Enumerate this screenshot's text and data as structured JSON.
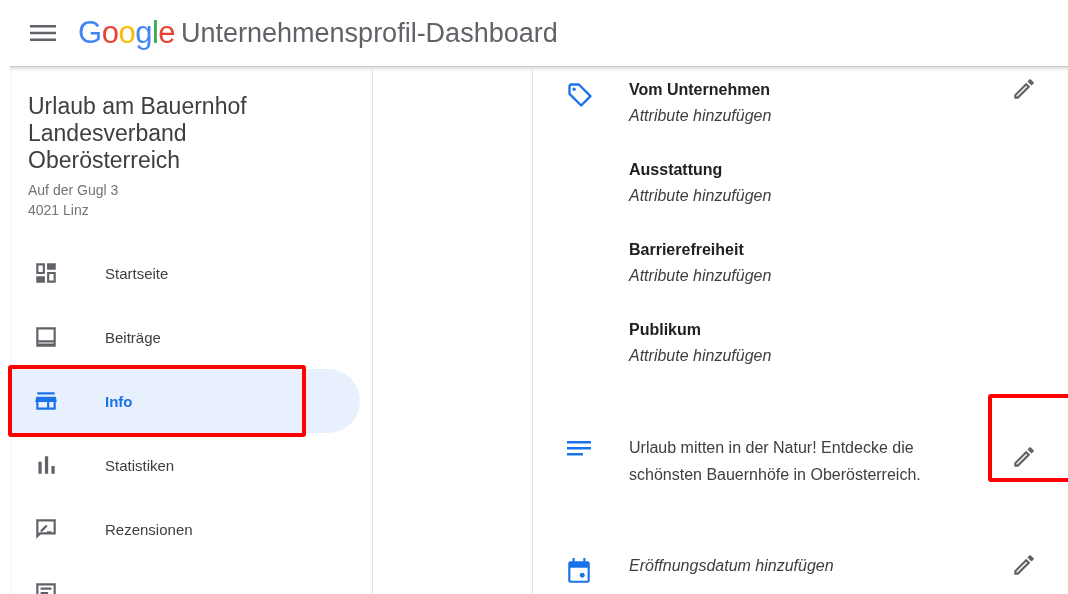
{
  "header": {
    "logo_letters": [
      {
        "char": "G",
        "color": "#4285f4"
      },
      {
        "char": "o",
        "color": "#ea4335"
      },
      {
        "char": "o",
        "color": "#fbbc05"
      },
      {
        "char": "g",
        "color": "#4285f4"
      },
      {
        "char": "l",
        "color": "#34a853"
      },
      {
        "char": "e",
        "color": "#ea4335"
      }
    ],
    "title": "Unternehmensprofil-Dashboard"
  },
  "business": {
    "name": "Urlaub am Bauernhof Landesverband Oberösterreich",
    "address_lines": [
      "Auf der Gugl 3",
      "4021 Linz"
    ]
  },
  "nav": [
    {
      "kind": "dashboard",
      "label": "Startseite",
      "selected": false,
      "highlighted": false
    },
    {
      "kind": "posts",
      "label": "Beiträge",
      "selected": false,
      "highlighted": false
    },
    {
      "kind": "store",
      "label": "Info",
      "selected": true,
      "highlighted": true
    },
    {
      "kind": "chart",
      "label": "Statistiken",
      "selected": false,
      "highlighted": false
    },
    {
      "kind": "review",
      "label": "Rezensionen",
      "selected": false,
      "highlighted": false
    },
    {
      "kind": "message",
      "selected": false,
      "highlighted": false
    }
  ],
  "sections": [
    {
      "kind": "attributes",
      "groups": [
        {
          "title": "Vom Unternehmen",
          "value": "Attribute hinzufügen"
        },
        {
          "title": "Ausstattung",
          "value": "Attribute hinzufügen"
        },
        {
          "title": "Barrierefreiheit",
          "value": "Attribute hinzufügen"
        },
        {
          "title": "Publikum",
          "value": "Attribute hinzufügen"
        }
      ],
      "edit_highlighted": false
    },
    {
      "kind": "description",
      "text": "Urlaub mitten in der Natur! Entdecke die schönsten Bauernhöfe in Oberösterreich.",
      "edit_highlighted": true
    },
    {
      "kind": "date",
      "text": "Eröffnungsdatum hinzufügen",
      "edit_highlighted": false
    }
  ]
}
